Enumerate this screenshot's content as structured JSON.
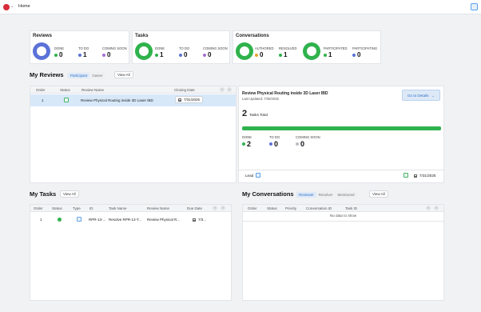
{
  "header": {
    "home_label": "Home"
  },
  "cards": {
    "reviews": {
      "title": "Reviews",
      "ring_color": "#5b72d8",
      "stats": [
        {
          "label": "DONE",
          "value": "0",
          "color": "#2fb24c"
        },
        {
          "label": "TO DO",
          "value": "1",
          "color": "#5b72d8"
        },
        {
          "label": "COMING SOON",
          "value": "0",
          "color": "#a76fd6"
        }
      ]
    },
    "tasks": {
      "title": "Tasks",
      "ring_color": "#2fb24c",
      "stats": [
        {
          "label": "DONE",
          "value": "1",
          "color": "#2fb24c"
        },
        {
          "label": "TO DO",
          "value": "0",
          "color": "#5b72d8"
        },
        {
          "label": "COMING SOON",
          "value": "0",
          "color": "#a76fd6"
        }
      ]
    },
    "conversations": {
      "title": "Conversations",
      "ring_color": "#2fb24c",
      "stats": [
        {
          "label": "AUTHORED",
          "value": "0",
          "color": "#e8a42a"
        },
        {
          "label": "RESOLVED",
          "value": "1",
          "color": "#2fb24c"
        },
        {
          "label": "PARTICIPATED",
          "value": "1",
          "color": "#2fb24c"
        },
        {
          "label": "PARTICIPATING",
          "value": "0",
          "color": "#5b72d8"
        }
      ]
    }
  },
  "my_reviews": {
    "title": "My Reviews",
    "tabs": [
      "Participant",
      "Owner"
    ],
    "active_tab": "Participant",
    "view_all": "View All",
    "columns": [
      "Order",
      "Status",
      "Review Name",
      "Closing Date"
    ],
    "rows": [
      {
        "order": "1",
        "name": "Review Physical Routing inside 3D Laser IBD",
        "closing_date": "7/31/2025"
      }
    ],
    "detail": {
      "name": "Review Physical Routing inside 3D Laser IBD",
      "last_updated": "Last Updated: 7/30/2025",
      "button": "Go to Details",
      "tasks_total_value": "2",
      "tasks_total_label": "Tasks Total",
      "progress": 1.0,
      "stats": [
        {
          "label": "DONE",
          "value": "2",
          "color": "#2fb24c"
        },
        {
          "label": "TO DO",
          "value": "0",
          "color": "#5b72d8"
        },
        {
          "label": "COMING SOON",
          "value": "0",
          "color": "#b9bec5"
        }
      ],
      "lead_label": "Lead",
      "footer_date": "7/31/2025"
    }
  },
  "my_tasks": {
    "title": "My Tasks",
    "view_all": "View All",
    "columns": [
      "Order",
      "Status",
      "Type",
      "ID",
      "Task Name",
      "Review Name",
      "Due Date"
    ],
    "rows": [
      {
        "order": "1",
        "id": "RPR-13-...",
        "task_name": "Resolve RPR-13-T...",
        "review_name": "Review Physical R...",
        "due_date": "7/3..."
      }
    ]
  },
  "my_conversations": {
    "title": "My Conversations",
    "tabs": [
      "Reviewer",
      "Resolver",
      "Mentioned"
    ],
    "active_tab": "Reviewer",
    "view_all": "View All",
    "columns": [
      "Order",
      "Status",
      "Priority",
      "Conversation ID",
      "Task ID"
    ],
    "empty_text": "No data to show"
  }
}
